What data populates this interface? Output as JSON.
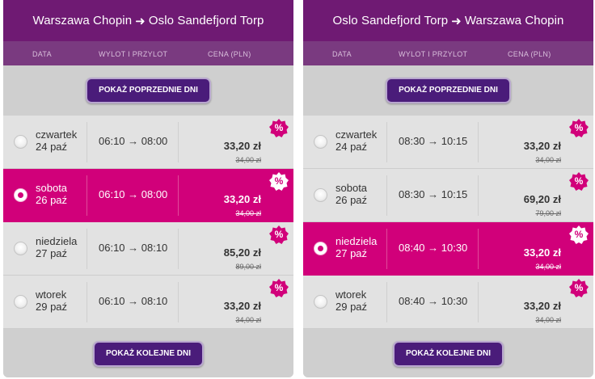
{
  "colors": {
    "header_bg": "#6f1a73",
    "selected_row": "#d1007a",
    "button_bg": "#4a1c7a",
    "badge": "#d1007a"
  },
  "columns": {
    "date": "DATA",
    "times": "WYLOT I PRZYLOT",
    "price": "CENA (PLN)"
  },
  "panels": [
    {
      "from": "Warszawa Chopin",
      "arrow": "➜",
      "to": "Oslo Sandefjord Torp",
      "prev_button": "POKAŻ POPRZEDNIE DNI",
      "next_button": "POKAŻ KOLEJNE DNI",
      "rows": [
        {
          "day": "czwartek",
          "date": "24 paź",
          "times": "06:10 → 08:00",
          "price": "33,20 zł",
          "old_price": "34,00 zł",
          "selected": false,
          "badge": "%"
        },
        {
          "day": "sobota",
          "date": "26 paź",
          "times": "06:10 → 08:00",
          "price": "33,20 zł",
          "old_price": "34,00 zł",
          "selected": true,
          "badge": "%"
        },
        {
          "day": "niedziela",
          "date": "27 paź",
          "times": "06:10 → 08:10",
          "price": "85,20 zł",
          "old_price": "89,00 zł",
          "selected": false,
          "badge": "%"
        },
        {
          "day": "wtorek",
          "date": "29 paź",
          "times": "06:10 → 08:10",
          "price": "33,20 zł",
          "old_price": "34,00 zł",
          "selected": false,
          "badge": "%"
        }
      ]
    },
    {
      "from": "Oslo Sandefjord Torp",
      "arrow": "➜",
      "to": "Warszawa Chopin",
      "prev_button": "POKAŻ POPRZEDNIE DNI",
      "next_button": "POKAŻ KOLEJNE DNI",
      "rows": [
        {
          "day": "czwartek",
          "date": "24 paź",
          "times": "08:30 → 10:15",
          "price": "33,20 zł",
          "old_price": "34,00 zł",
          "selected": false,
          "badge": "%"
        },
        {
          "day": "sobota",
          "date": "26 paź",
          "times": "08:30 → 10:15",
          "price": "69,20 zł",
          "old_price": "79,00 zł",
          "selected": false,
          "badge": "%"
        },
        {
          "day": "niedziela",
          "date": "27 paź",
          "times": "08:40 → 10:30",
          "price": "33,20 zł",
          "old_price": "34,00 zł",
          "selected": true,
          "badge": "%"
        },
        {
          "day": "wtorek",
          "date": "29 paź",
          "times": "08:40 → 10:30",
          "price": "33,20 zł",
          "old_price": "34,00 zł",
          "selected": false,
          "badge": "%"
        }
      ]
    }
  ]
}
